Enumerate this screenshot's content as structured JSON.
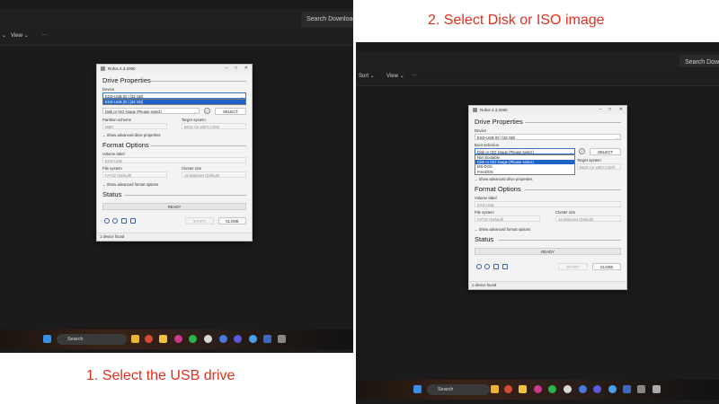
{
  "captions": {
    "step1": "1. Select the USB drive",
    "step2": "2. Select Disk or ISO image"
  },
  "explorer": {
    "search_left": "Search Downloads",
    "search_right": "Search Downl",
    "toolbar_left": [
      "⌄",
      "View ⌄",
      "···"
    ],
    "toolbar_right": [
      "Sort ⌄",
      "View ⌄",
      "···"
    ]
  },
  "taskbar": {
    "search": "Search"
  },
  "rufus": {
    "title": "Rufus 4.3.2090",
    "drive_properties": "Drive Properties",
    "device_label": "Device",
    "device_value": "ESD-USB (D:) [32 GB]",
    "boot_selection_label": "Boot selection",
    "boot_value": "Disk or ISO image (Please select)",
    "select_button": "SELECT",
    "partition_scheme_label": "Partition scheme",
    "partition_scheme_value": "MBR",
    "target_system_label": "Target system",
    "target_system_value": "BIOS (or UEFI-CSM)",
    "show_advanced_drive": "Show advanced drive properties",
    "format_options": "Format Options",
    "volume_label_label": "Volume label",
    "volume_label_value": "ESD-USB",
    "file_system_label": "File system",
    "file_system_value": "FAT32 (Default)",
    "cluster_size_label": "Cluster size",
    "cluster_size_value": "16 kilobytes (Default)",
    "show_advanced_format": "Show advanced format options",
    "status": "Status",
    "ready": "READY",
    "start_button": "START",
    "close_button": "CLOSE",
    "footer": "1 device found",
    "device_dropdown_options": [
      "ESD-USB (D:) [32 GB]"
    ],
    "boot_dropdown_options": [
      "Non bootable",
      "Disk or ISO image (Please select)",
      "MS-DOS",
      "FreeDOS"
    ],
    "boot_dropdown_selected_index": 1
  },
  "colors": {
    "caption": "#e0301e",
    "selection": "#1f63c6"
  }
}
